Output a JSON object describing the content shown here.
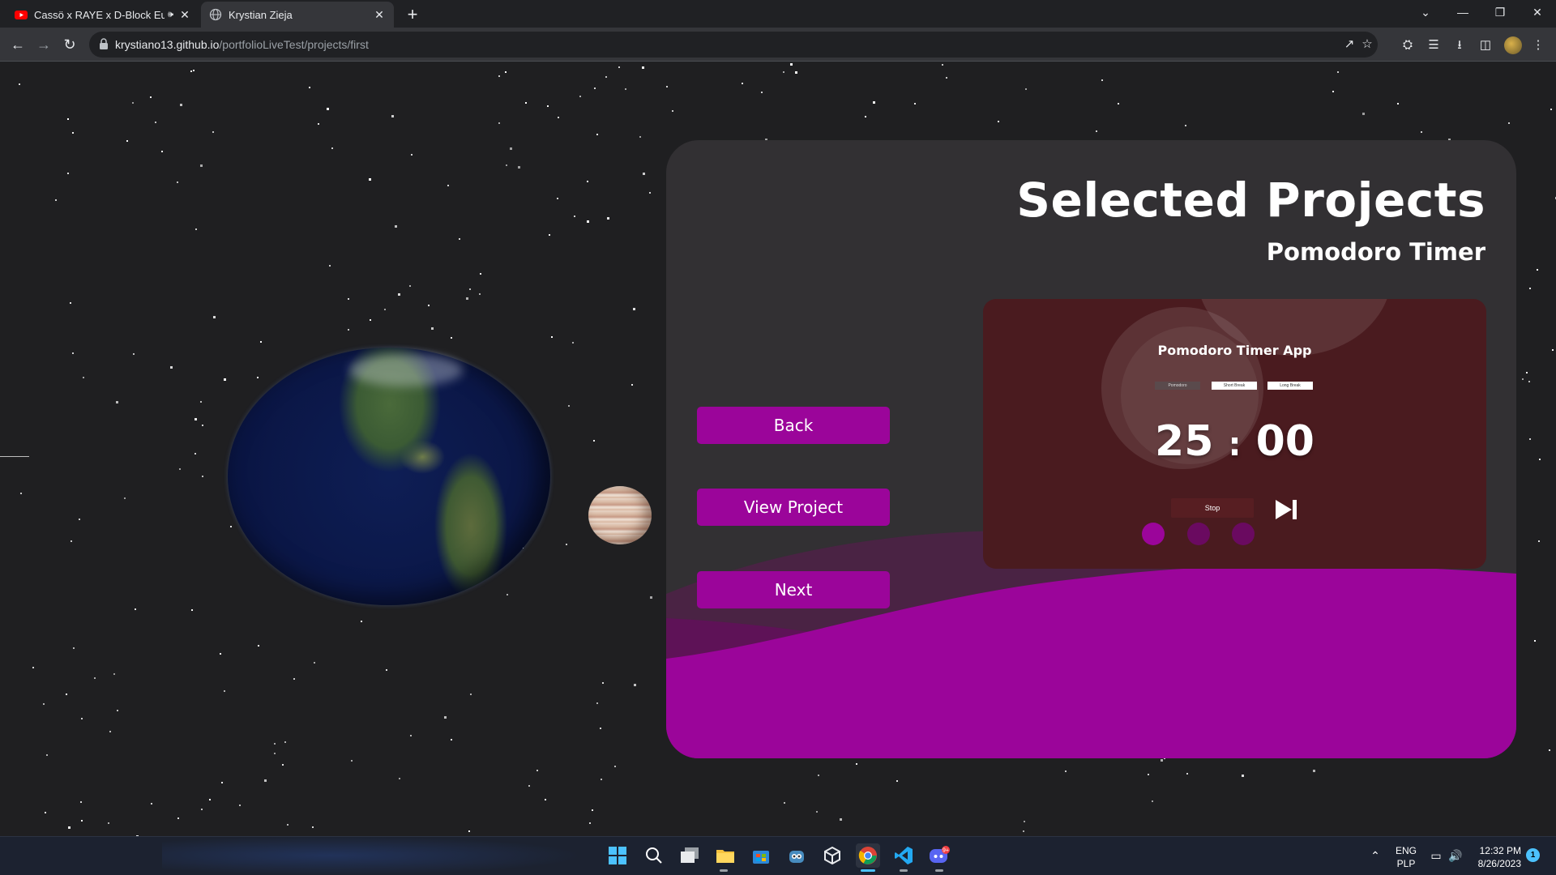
{
  "browser": {
    "tabs": [
      {
        "title": "Cassö x RAYE x D-Block Europ",
        "favicon": "youtube-icon",
        "audio": "speaker-icon",
        "active": false
      },
      {
        "title": "Krystian Zieja",
        "favicon": "globe-icon",
        "active": true
      }
    ],
    "url_host": "krystiano13.github.io",
    "url_path": "/portfolioLiveTest/projects/first",
    "toolbar_icons": [
      "share-icon",
      "star-icon",
      "extensions-icon",
      "media-icon",
      "download-icon",
      "sidepanel-icon",
      "profile-avatar",
      "menu-icon"
    ]
  },
  "page": {
    "heading": "Selected Projects",
    "project_name": "Pomodoro Timer",
    "buttons": {
      "back": "Back",
      "view": "View Project",
      "next": "Next"
    },
    "preview": {
      "app_title": "Pomodoro Timer App",
      "modes": [
        "Pomodoro",
        "Short Break",
        "Long Break"
      ],
      "minutes": "25",
      "separator": ":",
      "seconds": "00",
      "stop_label": "Stop"
    },
    "colors": {
      "accent": "#9b059a",
      "card": "#323033",
      "background": "#1f1f21",
      "preview_bg": "#4a1b1f"
    }
  },
  "taskbar": {
    "apps": [
      "windows-start-icon",
      "search-icon",
      "task-view-icon",
      "file-explorer-icon",
      "microsoft-store-icon",
      "godot-icon",
      "unity-icon",
      "chrome-icon",
      "vscode-icon",
      "discord-icon"
    ],
    "discord_badge": "9+",
    "language": "ENG",
    "layout": "PLP",
    "time": "12:32 PM",
    "date": "8/26/2023",
    "notification_count": "1"
  }
}
